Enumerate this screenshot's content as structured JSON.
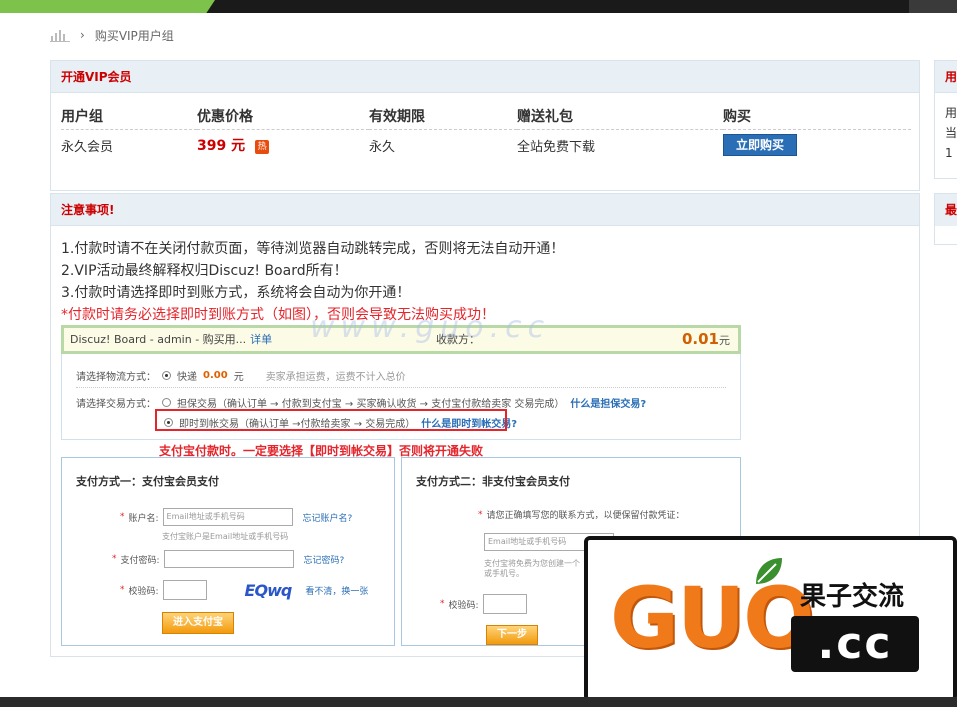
{
  "breadcrumb": {
    "separator": "›",
    "current": "购买VIP用户组"
  },
  "vip_panel": {
    "title": "开通VIP会员",
    "headers": [
      "用户组",
      "优惠价格",
      "有效期限",
      "赠送礼包",
      "购买"
    ],
    "row": {
      "group": "永久会员",
      "price": "399 元",
      "hot_badge": "热",
      "validity": "永久",
      "gift": "全站免费下载",
      "buy_label": "立即购买"
    }
  },
  "notice_panel": {
    "title": "注意事项!",
    "lines": [
      "1.付款时请不在关闭付款页面，等待浏览器自动跳转完成，否则将无法自动开通！",
      "2.VIP活动最终解释权归Discuz! Board所有！",
      "3.付款时请选择即时到账方式，系统将会自动为你开通！"
    ],
    "warning": "*付款时请务必选择即时到账方式（如图），否则会导致无法购买成功！"
  },
  "screenshot": {
    "bar_title": "Discuz! Board - admin - 购买用...",
    "bar_detail": "详单",
    "seller_label": "收款方：",
    "amount": "0.01",
    "amount_unit": "元",
    "logistics_label": "请选择物流方式：",
    "logistics_option": "快递",
    "logistics_fee": "0.00",
    "logistics_unit": "元",
    "logistics_note": "卖家承担运费，运费不计入总价",
    "trade_label": "请选择交易方式：",
    "trade_option1": "担保交易（确认订单 → 付款到支付宝 → 买家确认收货 → 支付宝付款给卖家 交易完成）",
    "trade_option1_link": "什么是担保交易?",
    "trade_option2": "即时到帐交易（确认订单 →付款给卖家 → 交易完成）",
    "trade_option2_link": "什么是即时到帐交易?",
    "red_message": "支付宝付款时。一定要选择【即时到帐交易】否则将开通失败",
    "method1": {
      "title": "支付方式一：支付宝会员支付",
      "account_label": "账户名:",
      "account_placeholder": "Email地址或手机号码",
      "account_hint": "支付宝账户是Email地址或手机号码",
      "forgot_account": "忘记账户名?",
      "password_label": "支付密码:",
      "forgot_password": "忘记密码?",
      "captcha_label": "校验码:",
      "captcha_text": "EQwq",
      "refresh_link": "看不清，换一张",
      "submit": "进入支付宝"
    },
    "method2": {
      "title": "支付方式二：非支付宝会员支付",
      "contact_label": "请您正确填写您的联系方式，以便保留付款凭证：",
      "contact_placeholder": "Email地址或手机号码",
      "contact_hint": "支付宝将免费为您创建一个",
      "contact_hint2": "或手机号。",
      "captcha_label": "校验码:",
      "next": "下一步"
    }
  },
  "sidebar": {
    "box1_title": "用",
    "box1_lines": [
      "用",
      "当",
      "1"
    ],
    "box2_title": "最"
  },
  "watermark": {
    "text": "www.guo.cc"
  },
  "logo": {
    "latin": "GUO",
    "domain": ".cc",
    "chinese": "果子交流"
  },
  "colors": {
    "accent_red": "#cc0000",
    "link_blue": "#2a6eb6",
    "header_bg": "#e8eff5",
    "logo_orange": "#f07a1a"
  }
}
